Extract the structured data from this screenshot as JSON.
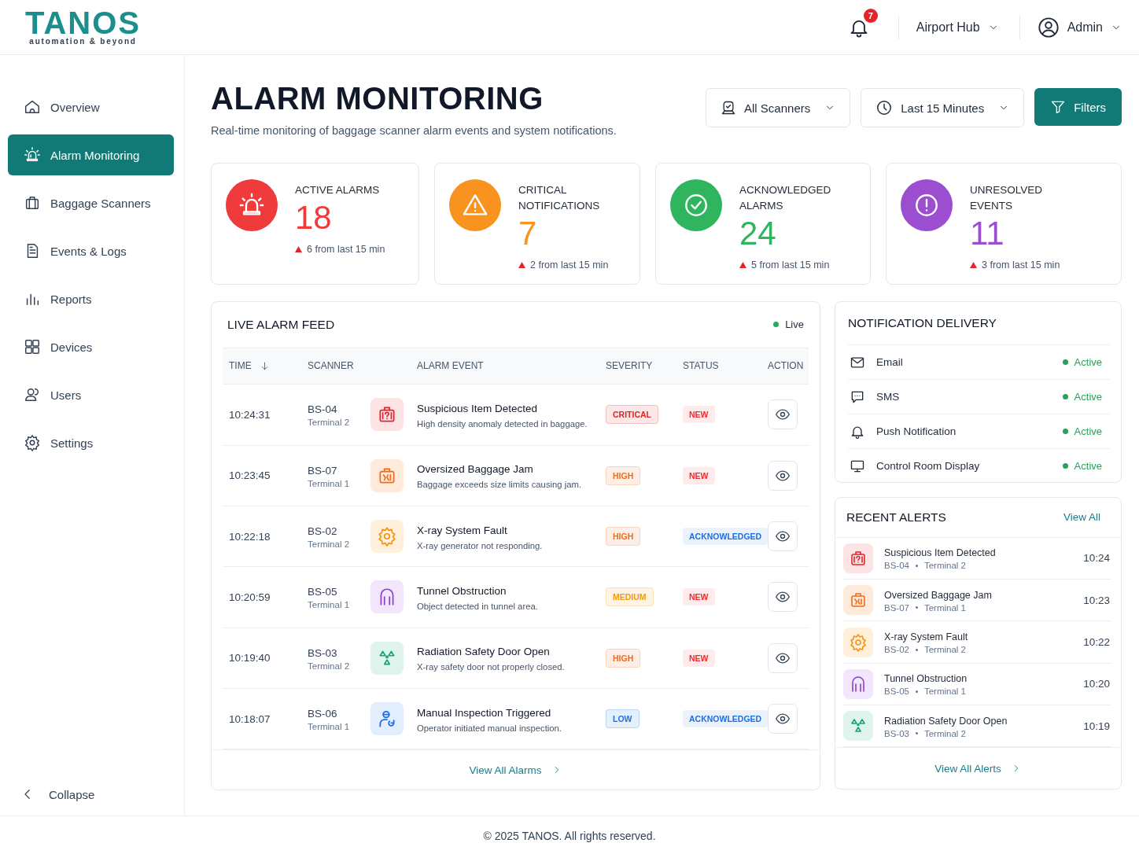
{
  "brand": {
    "name": "TANOS",
    "tagline": "automation & beyond"
  },
  "header": {
    "notifications": "7",
    "location": "Airport Hub",
    "user": "Admin"
  },
  "sidebar": {
    "items": [
      {
        "label": "Overview",
        "selected": false
      },
      {
        "label": "Alarm Monitoring",
        "selected": true
      },
      {
        "label": "Baggage Scanners",
        "selected": false
      },
      {
        "label": "Events & Logs",
        "selected": false
      },
      {
        "label": "Reports",
        "selected": false
      },
      {
        "label": "Devices",
        "selected": false
      },
      {
        "label": "Users",
        "selected": false
      },
      {
        "label": "Settings",
        "selected": false
      }
    ],
    "collapse": "Collapse"
  },
  "page": {
    "title": "ALARM MONITORING",
    "subtitle": "Real-time monitoring of baggage scanner alarm events and system notifications.",
    "scanner_filter": "All Scanners",
    "time_filter": "Last 15 Minutes",
    "filters_button": "Filters"
  },
  "stats": [
    {
      "label": "ACTIVE ALARMS",
      "value": "18",
      "trend": "6 from last 15 min",
      "color": "#ef3b3b"
    },
    {
      "label": "CRITICAL NOTIFICATIONS",
      "value": "7",
      "trend": "2 from last 15 min",
      "color": "#f7931e"
    },
    {
      "label": "ACKNOWLEDGED ALARMS",
      "value": "24",
      "trend": "5 from last 15 min",
      "color": "#2fb55d"
    },
    {
      "label": "UNRESOLVED EVENTS",
      "value": "11",
      "trend": "3 from last 15 min",
      "color": "#9b4fd0"
    }
  ],
  "feed": {
    "title": "LIVE ALARM FEED",
    "live": {
      "label": "Live",
      "on": true
    },
    "columns": [
      "TIME",
      "SCANNER",
      "ALARM EVENT",
      "SEVERITY",
      "STATUS",
      "ACTION"
    ],
    "rows": [
      {
        "time": "10:24:31",
        "scanner": "BS-04",
        "terminal": "Terminal 2",
        "kind": "suspicious",
        "event": "Suspicious Item Detected",
        "description": "High density anomaly detected in baggage.",
        "severity": {
          "label": "CRITICAL",
          "color": "#dc2626"
        },
        "status": {
          "label": "NEW",
          "color": "#ef2b2b"
        }
      },
      {
        "time": "10:23:45",
        "scanner": "BS-07",
        "terminal": "Terminal 1",
        "kind": "jam",
        "event": "Oversized Baggage Jam",
        "description": "Baggage exceeds size limits causing jam.",
        "severity": {
          "label": "HIGH",
          "color": "#f26b1d"
        },
        "status": {
          "label": "NEW",
          "color": "#ef2b2b"
        }
      },
      {
        "time": "10:22:18",
        "scanner": "BS-02",
        "terminal": "Terminal 2",
        "kind": "fault",
        "event": "X-ray System Fault",
        "description": "X-ray generator not responding.",
        "severity": {
          "label": "HIGH",
          "color": "#f26b1d"
        },
        "status": {
          "label": "ACKNOWLEDGED",
          "color": "#1d6fe0"
        }
      },
      {
        "time": "10:20:59",
        "scanner": "BS-05",
        "terminal": "Terminal 1",
        "kind": "tunnel",
        "event": "Tunnel Obstruction",
        "description": "Object detected in tunnel area.",
        "severity": {
          "label": "MEDIUM",
          "color": "#f29a0e"
        },
        "status": {
          "label": "NEW",
          "color": "#ef2b2b"
        }
      },
      {
        "time": "10:19:40",
        "scanner": "BS-03",
        "terminal": "Terminal 2",
        "kind": "radiation",
        "event": "Radiation Safety Door Open",
        "description": "X-ray safety door not properly closed.",
        "severity": {
          "label": "HIGH",
          "color": "#f26b1d"
        },
        "status": {
          "label": "NEW",
          "color": "#ef2b2b"
        }
      },
      {
        "time": "10:18:07",
        "scanner": "BS-06",
        "terminal": "Terminal 1",
        "kind": "inspection",
        "event": "Manual Inspection Triggered",
        "description": "Operator initiated manual inspection.",
        "severity": {
          "label": "LOW",
          "color": "#1d6fe0"
        },
        "status": {
          "label": "ACKNOWLEDGED",
          "color": "#1d6fe0"
        }
      }
    ],
    "footer_link": "View All Alarms"
  },
  "delivery": {
    "title": "NOTIFICATION DELIVERY",
    "channels": [
      {
        "name": "Email",
        "status": "Active",
        "active": true
      },
      {
        "name": "SMS",
        "status": "Active",
        "active": true
      },
      {
        "name": "Push Notification",
        "status": "Active",
        "active": true
      },
      {
        "name": "Control Room Display",
        "status": "Active",
        "active": true
      }
    ]
  },
  "recent": {
    "title": "RECENT ALERTS",
    "view_all": "View All",
    "items": [
      {
        "kind": "suspicious",
        "title": "Suspicious Item Detected",
        "scanner": "BS-04",
        "terminal": "Terminal 2",
        "time": "10:24"
      },
      {
        "kind": "jam",
        "title": "Oversized Baggage Jam",
        "scanner": "BS-07",
        "terminal": "Terminal 1",
        "time": "10:23"
      },
      {
        "kind": "fault",
        "title": "X-ray System Fault",
        "scanner": "BS-02",
        "terminal": "Terminal 2",
        "time": "10:22"
      },
      {
        "kind": "tunnel",
        "title": "Tunnel Obstruction",
        "scanner": "BS-05",
        "terminal": "Terminal 1",
        "time": "10:20"
      },
      {
        "kind": "radiation",
        "title": "Radiation Safety Door Open",
        "scanner": "BS-03",
        "terminal": "Terminal 2",
        "time": "10:19"
      }
    ],
    "footer_link": "View All Alerts"
  },
  "footer": "© 2025 TANOS. All rights reserved."
}
